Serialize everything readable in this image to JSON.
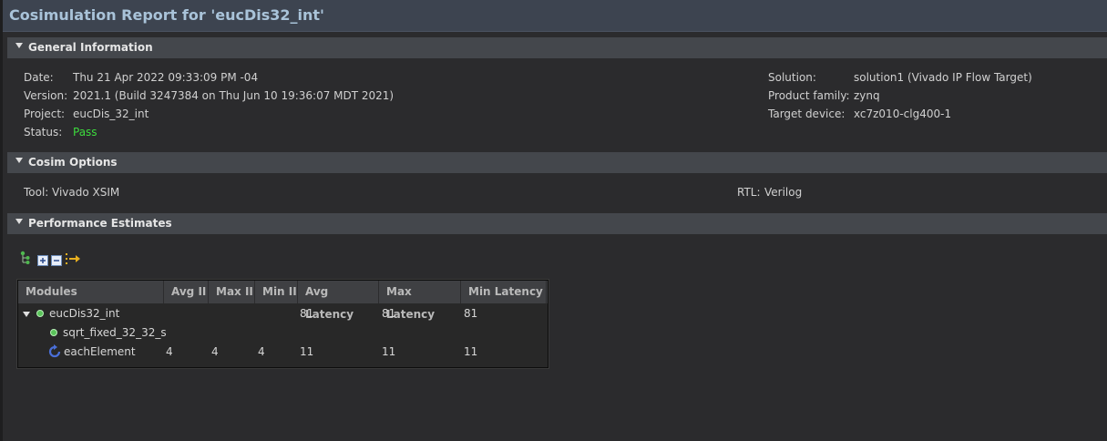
{
  "header": {
    "title": "Cosimulation Report for 'eucDis32_int'"
  },
  "general": {
    "heading": "General Information",
    "left": [
      {
        "key": "Date:",
        "value": "Thu 21 Apr 2022 09:33:09 PM -04"
      },
      {
        "key": "Version:",
        "value": "2021.1 (Build 3247384 on Thu Jun 10 19:36:07 MDT 2021)"
      },
      {
        "key": "Project:",
        "value": "eucDis_32_int"
      },
      {
        "key": "Status:",
        "value": "Pass"
      }
    ],
    "right": [
      {
        "key": "Solution:",
        "value": "solution1 (Vivado IP Flow Target)"
      },
      {
        "key": "Product family:",
        "value": "zynq"
      },
      {
        "key": "Target device:",
        "value": "xc7z010-clg400-1"
      }
    ]
  },
  "cosim": {
    "heading": "Cosim Options",
    "tool_label": "Tool:",
    "tool_value": "Vivado XSIM",
    "rtl_label": "RTL:",
    "rtl_value": "Verilog"
  },
  "performance": {
    "heading": "Performance Estimates",
    "toolbar_icons": [
      "hierarchy-icon",
      "expand-all-icon",
      "collapse-all-icon",
      "go-to-source-icon"
    ],
    "columns": [
      "Modules",
      "Avg II",
      "Max II",
      "Min II",
      "Avg Latency",
      "Max Latency",
      "Min Latency"
    ],
    "rows": [
      {
        "name": "eucDis32_int",
        "icon": "module-dot-icon",
        "expanded": true,
        "avg_ii": "",
        "max_ii": "",
        "min_ii": "",
        "avg_lat": "81",
        "max_lat": "81",
        "min_lat": "81"
      },
      {
        "name": "sqrt_fixed_32_32_s",
        "icon": "module-dot-icon",
        "avg_ii": "",
        "max_ii": "",
        "min_ii": "",
        "avg_lat": "",
        "max_lat": "",
        "min_lat": ""
      },
      {
        "name": "eachElement",
        "icon": "loop-icon",
        "avg_ii": "4",
        "max_ii": "4",
        "min_ii": "4",
        "avg_lat": "11",
        "max_lat": "11",
        "min_lat": "11"
      }
    ]
  },
  "colors": {
    "pass": "#3ddc3d",
    "title": "#a9c3d9",
    "background": "#2b2b2d"
  }
}
